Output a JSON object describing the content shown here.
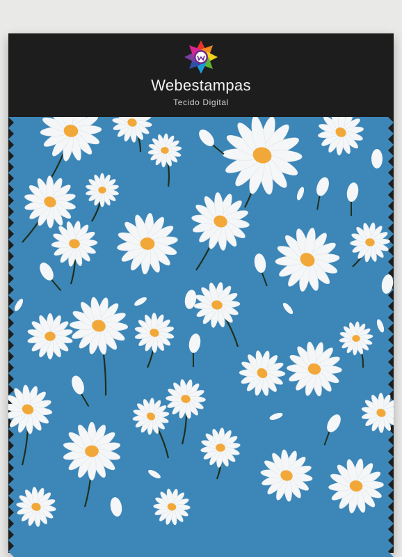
{
  "brand": {
    "name": "Webestampas",
    "tagline": "Tecido Digital",
    "logo_icon": "webestampas-logo-icon"
  },
  "fabric": {
    "background_color": "#3c86b8",
    "petal_color": "#f4f6f7",
    "center_color": "#f2a838",
    "stem_color": "#1f2f1c",
    "pattern": "white daisies"
  },
  "colors": {
    "frame": "#1d1d1d",
    "page": "#e9e9e7"
  }
}
